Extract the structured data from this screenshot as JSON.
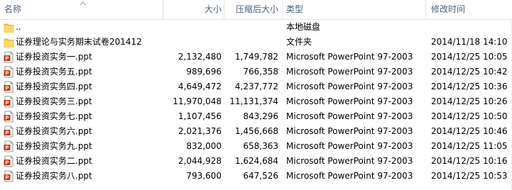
{
  "columns": {
    "name": "名称",
    "size": "大小",
    "compressed": "压缩后大小",
    "type": "类型",
    "modified": "修改时间"
  },
  "colors": {
    "header_text": "#4c607a",
    "folder_yellow": "#f5c84c",
    "ppt_red": "#c43e1c"
  },
  "rows": [
    {
      "icon": "folder-icon",
      "name": "..",
      "size": "",
      "compressed": "",
      "type": "本地磁盘",
      "modified": ""
    },
    {
      "icon": "folder-icon",
      "name": "证券理论与实务期末试卷201412",
      "size": "",
      "compressed": "",
      "type": "文件夹",
      "modified": "2014/11/18 14:10"
    },
    {
      "icon": "ppt-file-icon",
      "name": "证券投资实务一.ppt",
      "size": "2,132,480",
      "compressed": "1,749,782",
      "type": "Microsoft PowerPoint 97-2003 ...",
      "modified": "2014/12/25 10:05"
    },
    {
      "icon": "ppt-file-icon",
      "name": "证券投资实务五.ppt",
      "size": "989,696",
      "compressed": "766,358",
      "type": "Microsoft PowerPoint 97-2003 ...",
      "modified": "2014/12/25 10:42"
    },
    {
      "icon": "ppt-file-icon",
      "name": "证券投资实务四.ppt",
      "size": "4,649,472",
      "compressed": "4,237,772",
      "type": "Microsoft PowerPoint 97-2003 ...",
      "modified": "2014/12/25 10:36"
    },
    {
      "icon": "ppt-file-icon",
      "name": "证券投资实务三.ppt",
      "size": "11,970,048",
      "compressed": "11,131,374",
      "type": "Microsoft PowerPoint 97-2003 ...",
      "modified": "2014/12/25 10:26"
    },
    {
      "icon": "ppt-file-icon",
      "name": "证券投资实务七.ppt",
      "size": "1,107,456",
      "compressed": "843,296",
      "type": "Microsoft PowerPoint 97-2003 ...",
      "modified": "2014/12/25 10:50"
    },
    {
      "icon": "ppt-file-icon",
      "name": "证券投资实务六.ppt",
      "size": "2,021,376",
      "compressed": "1,456,668",
      "type": "Microsoft PowerPoint 97-2003 ...",
      "modified": "2014/12/25 10:46"
    },
    {
      "icon": "ppt-file-icon",
      "name": "证券投资实务九.ppt",
      "size": "832,000",
      "compressed": "658,363",
      "type": "Microsoft PowerPoint 97-2003 ...",
      "modified": "2014/12/25 11:05"
    },
    {
      "icon": "ppt-file-icon",
      "name": "证券投资实务二.ppt",
      "size": "2,044,928",
      "compressed": "1,624,684",
      "type": "Microsoft PowerPoint 97-2003 ...",
      "modified": "2014/12/25 10:16"
    },
    {
      "icon": "ppt-file-icon",
      "name": "证券投资实务八.ppt",
      "size": "793,600",
      "compressed": "647,526",
      "type": "Microsoft PowerPoint 97-2003 ...",
      "modified": "2014/12/25 10:53"
    }
  ]
}
